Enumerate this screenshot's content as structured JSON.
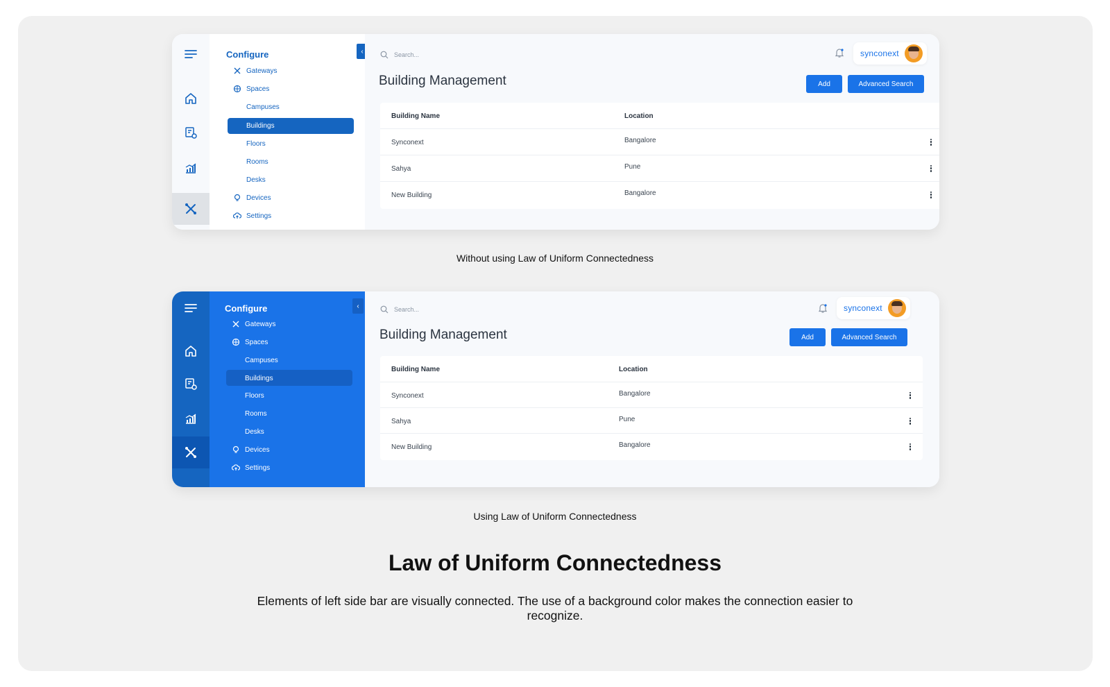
{
  "panels": [
    {
      "variant": "default",
      "rail_icons": [
        "menu-icon",
        "home-icon",
        "settings-doc-icon",
        "analytics-icon",
        "configure-tools-icon"
      ],
      "sidebar": {
        "title": "Configure",
        "items": [
          "Gateways",
          "Spaces",
          "Campuses",
          "Buildings",
          "Floors",
          "Rooms",
          "Desks",
          "Devices",
          "Settings"
        ],
        "selected": "Buildings"
      },
      "search_placeholder": "Search...",
      "brand": "synconext",
      "page_title": "Building Management",
      "buttons": {
        "add": "Add",
        "advanced_search": "Advanced Search"
      },
      "table": {
        "headers": [
          "Building Name",
          "Location"
        ],
        "rows": [
          [
            "Synconext",
            "Bangalore"
          ],
          [
            "Sahya",
            "Pune"
          ],
          [
            "New Building",
            "Bangalore"
          ]
        ]
      },
      "caption": "Without using Law of Uniform Connectedness"
    },
    {
      "variant": "colored",
      "rail_icons": [
        "menu-icon",
        "home-icon",
        "settings-doc-icon",
        "analytics-icon",
        "configure-tools-icon"
      ],
      "sidebar": {
        "title": "Configure",
        "items": [
          "Gateways",
          "Spaces",
          "Campuses",
          "Buildings",
          "Floors",
          "Rooms",
          "Desks",
          "Devices",
          "Settings"
        ],
        "selected": "Buildings"
      },
      "search_placeholder": "Search...",
      "brand": "synconext",
      "page_title": "Building Management",
      "buttons": {
        "add": "Add",
        "advanced_search": "Advanced Search"
      },
      "table": {
        "headers": [
          "Building Name",
          "Location"
        ],
        "rows": [
          [
            "Synconext",
            "Bangalore"
          ],
          [
            "Sahya",
            "Pune"
          ],
          [
            "New Building",
            "Bangalore"
          ]
        ]
      },
      "caption": "Using Law of Uniform Connectedness"
    }
  ],
  "heading": "Law of Uniform Connectedness",
  "description": "Elements of left side bar are visually connected. The use of a background color makes the connection easier to recognize.",
  "colors": {
    "primary": "#1a73e8",
    "primary_dark": "#1565c0",
    "canvas": "#f0f0f0"
  }
}
